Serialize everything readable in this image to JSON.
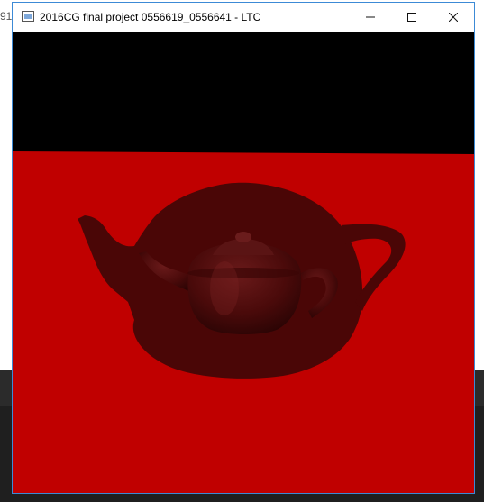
{
  "desktop": {
    "background_text": "91"
  },
  "window": {
    "title": "2016CG final project 0556619_0556641 - LTC",
    "controls": {
      "minimize": "minimize-icon",
      "maximize": "maximize-icon",
      "close": "close-icon"
    }
  },
  "scene": {
    "sky_color": "#000000",
    "floor_color": "#c00000",
    "shadow_color": "#4a0606",
    "teapot_color": "#4a0a0a"
  }
}
